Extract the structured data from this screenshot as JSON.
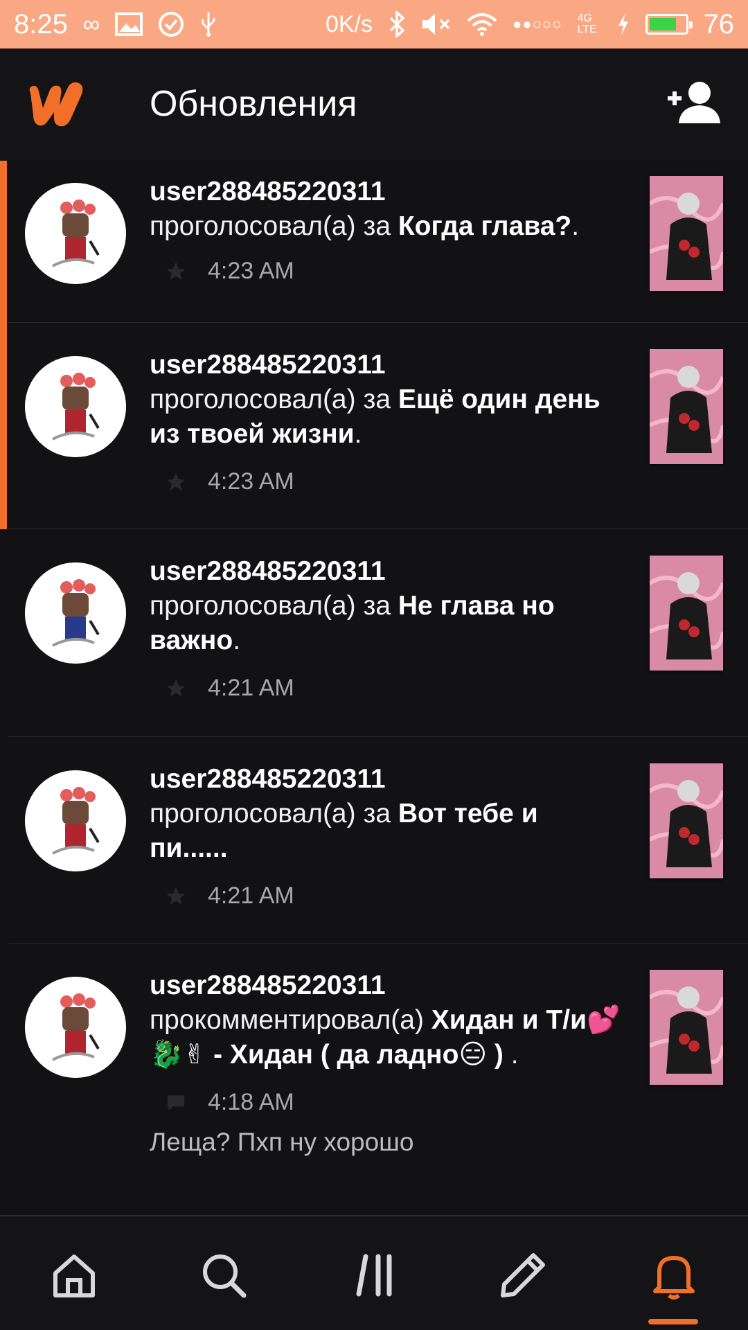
{
  "status_bar": {
    "time": "8:25",
    "net_speed": "0K/s",
    "network": "4G LTE",
    "battery": "76",
    "battery_level": 0.76,
    "accent_color": "#f9a883"
  },
  "app_bar": {
    "title": "Обновления",
    "logo": "wattpad-logo",
    "action_icon": "add-user-icon"
  },
  "colors": {
    "brand": "#f26f2a",
    "background": "#121114",
    "meta_text": "#a8a7ab"
  },
  "notifications": [
    {
      "username": "user288485220311",
      "action": "проголосовал(а) за ",
      "target": "Когда глава?",
      "suffix": ".",
      "time": "4:23 AM",
      "icon": "star-icon",
      "unread": true
    },
    {
      "username": "user288485220311",
      "action": "проголосовал(а) за ",
      "target": "Ещё один день из твоей жизни",
      "suffix": ".",
      "time": "4:23 AM",
      "icon": "star-icon",
      "unread": true
    },
    {
      "username": "user288485220311",
      "action": "проголосовал(а) за ",
      "target": "Не глава но важно",
      "suffix": ".",
      "time": "4:21 AM",
      "icon": "star-icon",
      "unread": false
    },
    {
      "username": "user288485220311",
      "action": "проголосовал(а) за ",
      "target": "Вот тебе и пи......",
      "suffix": "",
      "time": "4:21 AM",
      "icon": "star-icon",
      "unread": false
    },
    {
      "username": "user288485220311",
      "action": "прокомментировал(а) ",
      "target": "Хидан и Т/и💕🐉✌ - Хидан ( да ладно😑 )",
      "suffix": " .",
      "time": "4:18 AM",
      "icon": "comment-icon",
      "comment": "Леща? Пхп ну хорошо",
      "unread": false
    }
  ],
  "bottom_nav": {
    "items": [
      "home-icon",
      "search-icon",
      "library-icon",
      "write-icon",
      "notifications-icon"
    ],
    "active": "notifications-icon"
  }
}
